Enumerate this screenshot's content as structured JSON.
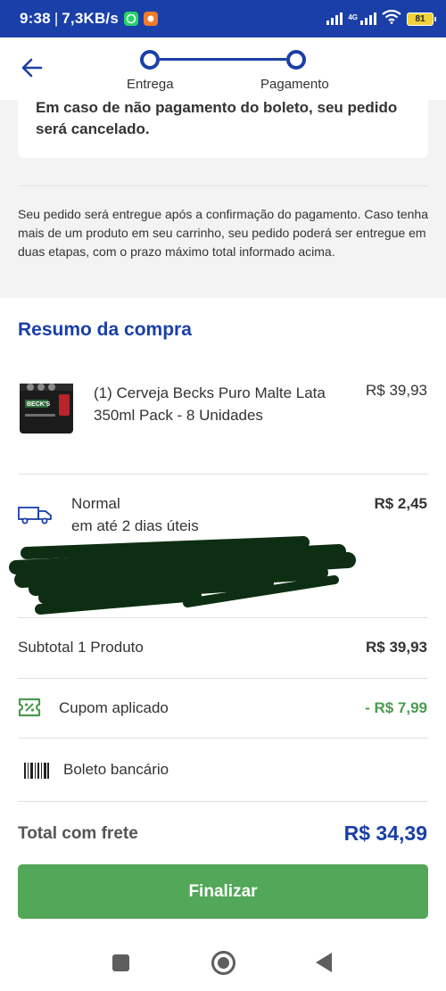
{
  "status_bar": {
    "time": "9:38",
    "speed": "7,3KB/s",
    "network": "4G",
    "battery": "81",
    "icons": [
      "whatsapp-icon",
      "app-notification-icon",
      "signal-icon",
      "signal-4g-icon",
      "wifi-icon",
      "battery-icon"
    ]
  },
  "header": {
    "back_icon": "arrow-left-icon",
    "steps": [
      {
        "label": "Entrega"
      },
      {
        "label": "Pagamento"
      }
    ]
  },
  "notice": {
    "warning": "Em caso de não pagamento do boleto, seu pedido será cancelado.",
    "info": "Seu pedido será entregue após a confirmação do pagamento. Caso tenha mais de um produto em seu carrinho, seu pedido poderá ser entregue em duas etapas, com o prazo máximo total informado acima."
  },
  "summary": {
    "title": "Resumo da compra",
    "product": {
      "name": "(1) Cerveja Becks Puro Malte Lata 350ml Pack - 8 Unidades",
      "price": "R$ 39,93",
      "brand_on_image": "BECK'S"
    },
    "shipping": {
      "name": "Normal",
      "days": "em até 2 dias úteis",
      "price": "R$ 2,45",
      "icon": "truck-icon"
    },
    "subtotal": {
      "label": "Subtotal 1 Produto",
      "value": "R$ 39,93"
    },
    "coupon": {
      "label": "Cupom aplicado",
      "value": "- R$ 7,99",
      "icon": "coupon-ticket-icon"
    },
    "payment": {
      "label": "Boleto bancário",
      "icon": "barcode-icon"
    },
    "total": {
      "label": "Total com frete",
      "value": "R$ 34,39"
    }
  },
  "finalize_button": "Finalizar",
  "colors": {
    "brand_blue": "#1a3fa8",
    "success_green": "#52a758",
    "coupon_green": "#4a9c4e",
    "redaction": "#0d2e12"
  },
  "nav_bar": {
    "icons": [
      "recent-apps-icon",
      "home-icon",
      "back-icon"
    ]
  }
}
